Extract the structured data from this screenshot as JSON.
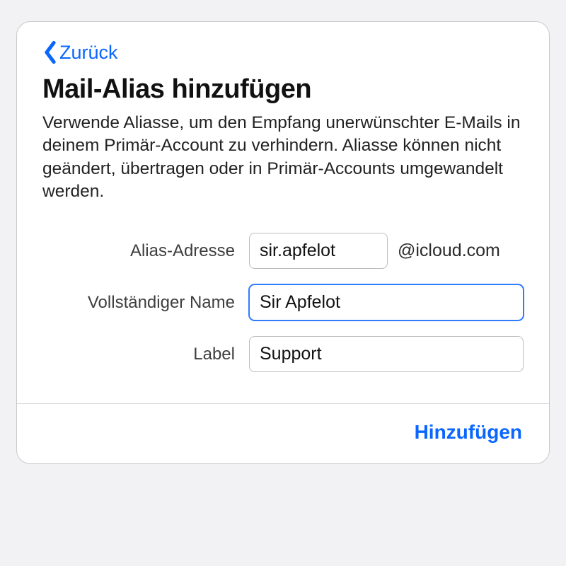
{
  "colors": {
    "accent": "#0a66ff",
    "sheet_border": "#c9c9cc",
    "field_border": "#bdbdbf",
    "focus_border": "#2f7cff",
    "page_bg": "#f2f2f4"
  },
  "nav": {
    "back_label": "Zurück"
  },
  "header": {
    "title": "Mail-Alias hinzufügen",
    "description": "Verwende Aliasse, um den Empfang unerwünschter E-Mails in deinem Primär-Account zu verhindern. Aliasse können nicht geändert, übertragen oder in Primär-Accounts umgewandelt werden."
  },
  "form": {
    "alias_address": {
      "label": "Alias-Adresse",
      "value": "sir.apfelot",
      "domain_suffix": "@icloud.com"
    },
    "full_name": {
      "label": "Vollständiger Name",
      "value": "Sir Apfelot",
      "focused": true
    },
    "label_field": {
      "label": "Label",
      "value": "Support"
    }
  },
  "footer": {
    "add_button": "Hinzufügen"
  }
}
